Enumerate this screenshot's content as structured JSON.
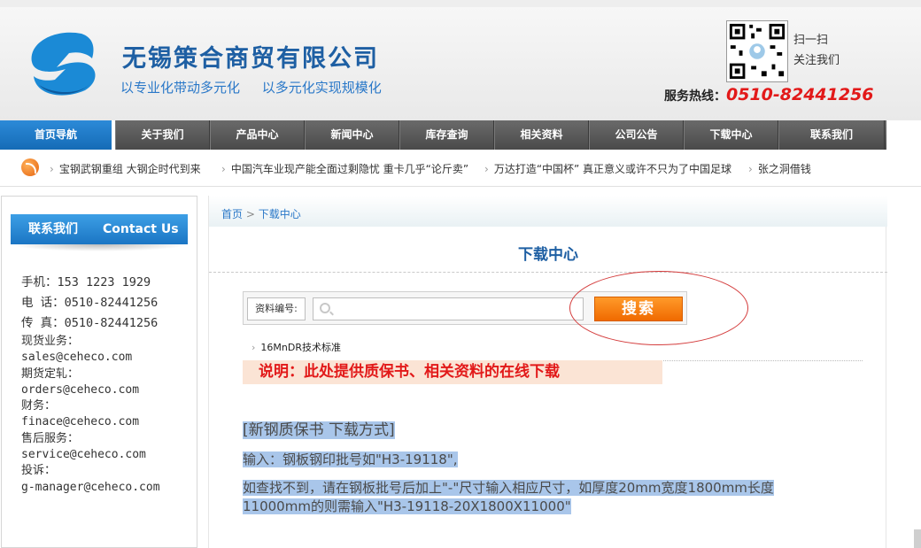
{
  "header": {
    "company_name": "无锡策合商贸有限公司",
    "slogan_1": "以专业化带动多元化",
    "slogan_2": "以多元化实现规模化",
    "qr_text_1": "扫一扫",
    "qr_text_2": "关注我们",
    "hotline_label": "服务热线：",
    "hotline_number": "0510-82441256"
  },
  "nav": [
    {
      "label": "首页导航",
      "active": true
    },
    {
      "label": "关于我们"
    },
    {
      "label": "产品中心"
    },
    {
      "label": "新闻中心"
    },
    {
      "label": "库存查询"
    },
    {
      "label": "相关资料"
    },
    {
      "label": "公司公告"
    },
    {
      "label": "下载中心"
    },
    {
      "label": "联系我们"
    }
  ],
  "news": [
    "宝钢武钢重组 大钢企时代到来",
    "中国汽车业现产能全面过剩隐忧 重卡几乎“论斤卖”",
    "万达打造“中国杯” 真正意义或许不只为了中国足球",
    "张之洞借钱"
  ],
  "sidebar": {
    "title_cn": "联系我们",
    "title_en": "Contact Us",
    "lines": [
      "手机：153 1223 1929",
      "电 话：0510-82441256",
      "传 真：0510-82441256",
      "现货业务：",
      "sales@ceheco.com",
      "期货定轧：",
      "orders@ceheco.com",
      "财务：",
      "finace@ceheco.com",
      "售后服务：",
      "service@ceheco.com",
      "投诉：",
      "g-manager@ceheco.com"
    ]
  },
  "breadcrumb": {
    "home": "首页",
    "separator": ">",
    "current": "下载中心"
  },
  "main": {
    "heading": "下载中心",
    "search_label": "资料编号:",
    "search_value": "",
    "search_button": "搜索",
    "doc_link": "16MnDR技术标准",
    "notice": "说明：此处提供质保书、相关资料的在线下载",
    "method_title": "[新钢质保书 下载方式]",
    "method_step1": "输入：钢板钢印批号如\"H3-19118\",",
    "method_step2_line1": "如查找不到，请在钢板批号后加上\"-\"尺寸输入相应尺寸，如厚度20mm宽度1800mm长度",
    "method_step2_line2": "11000mm的则需输入\"H3-19118-20X1800X11000\""
  },
  "colors": {
    "brand_blue": "#1e5fa3",
    "accent_orange": "#f06a00",
    "hotline_red": "#e21919",
    "nav_active": "#156bb6"
  }
}
